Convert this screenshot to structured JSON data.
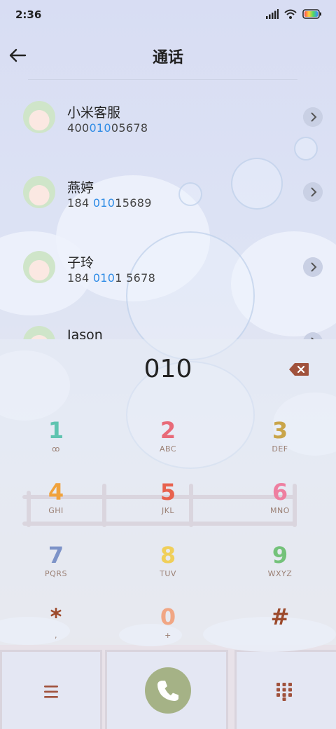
{
  "status": {
    "time": "2:36"
  },
  "header": {
    "title": "通话"
  },
  "contacts": [
    {
      "name": "小米客服",
      "num_pre": "400",
      "num_hl": "010",
      "num_post": "05678"
    },
    {
      "name": "燕婷",
      "num_pre": "184 ",
      "num_hl": "010",
      "num_post": "15689"
    },
    {
      "name": "子玲",
      "num_pre": "184 ",
      "num_hl": "010",
      "num_post": "1 5678"
    },
    {
      "name": "Jason",
      "num_pre": "",
      "num_hl": "",
      "num_post": ""
    }
  ],
  "dialer": {
    "entry": "010",
    "keys": [
      {
        "digit": "1",
        "letters": "ꝏ",
        "color": "#5fc4b0"
      },
      {
        "digit": "2",
        "letters": "ABC",
        "color": "#e86a78"
      },
      {
        "digit": "3",
        "letters": "DEF",
        "color": "#c9a54a"
      },
      {
        "digit": "4",
        "letters": "GHI",
        "color": "#f0a23c"
      },
      {
        "digit": "5",
        "letters": "JKL",
        "color": "#e8624e"
      },
      {
        "digit": "6",
        "letters": "MNO",
        "color": "#ee7fa0"
      },
      {
        "digit": "7",
        "letters": "PQRS",
        "color": "#7d93c8"
      },
      {
        "digit": "8",
        "letters": "TUV",
        "color": "#f0cf5a"
      },
      {
        "digit": "9",
        "letters": "WXYZ",
        "color": "#74c27a"
      },
      {
        "digit": "*",
        "letters": ",",
        "color": "#9c4a2c"
      },
      {
        "digit": "0",
        "letters": "+",
        "color": "#f1a684"
      },
      {
        "digit": "#",
        "letters": "",
        "color": "#9c4a2c"
      }
    ]
  },
  "colors": {
    "highlight": "#2f8ce6",
    "call_button": "#a5b286",
    "accent_brown": "#9c4a2c"
  },
  "icons": [
    "back-arrow-icon",
    "signal-icon",
    "wifi-icon",
    "battery-icon",
    "chevron-right-icon",
    "backspace-icon",
    "menu-icon",
    "phone-icon",
    "dialpad-icon"
  ]
}
